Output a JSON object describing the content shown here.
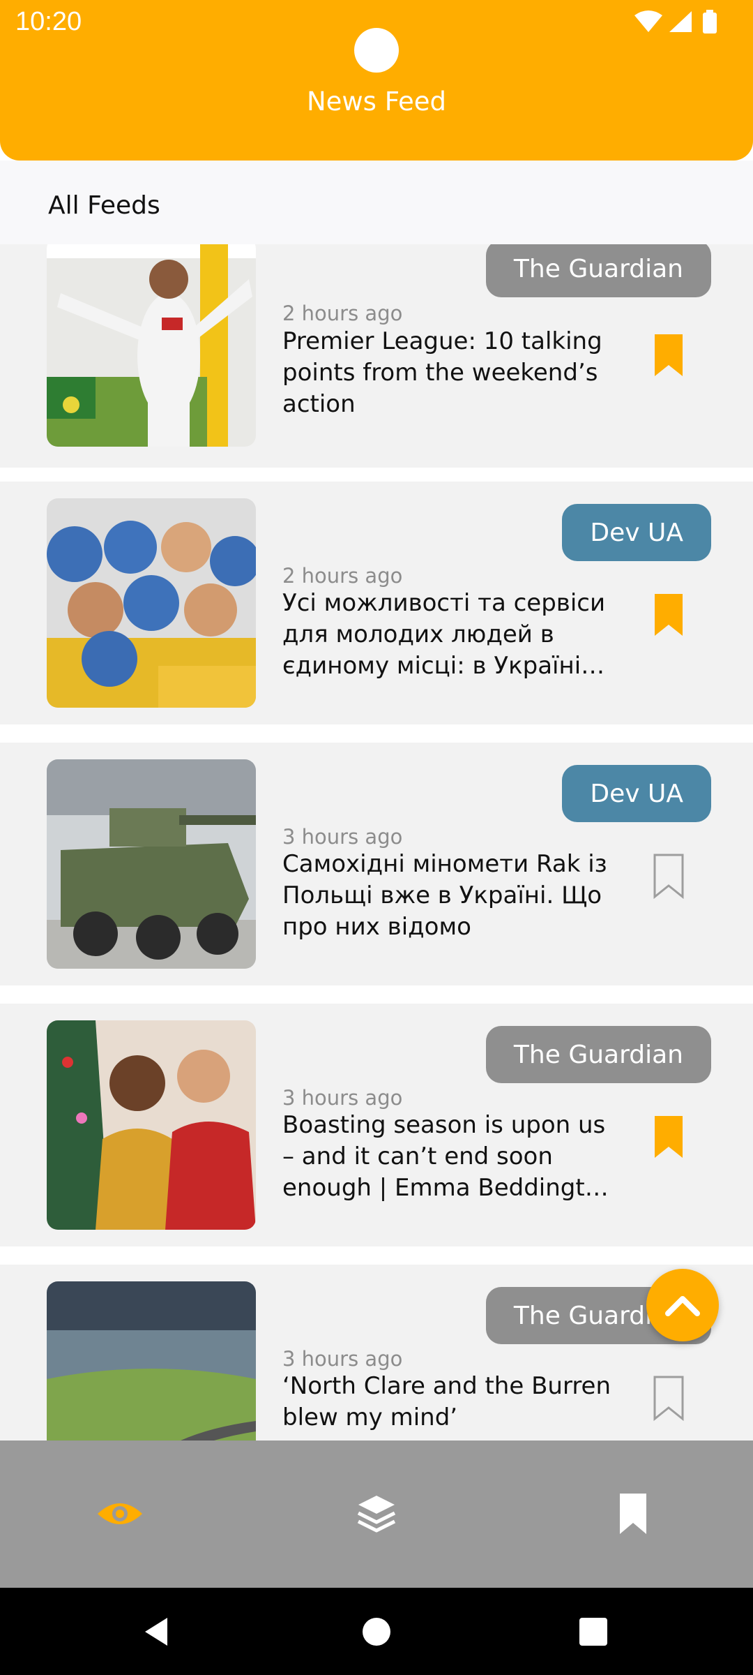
{
  "status_bar": {
    "time": "10:20"
  },
  "header": {
    "title": "News Feed"
  },
  "section": {
    "title": "All Feeds"
  },
  "articles": [
    {
      "source": "The Guardian",
      "time": "2 hours ago",
      "headline": "Premier League: 10 talking points from the weekend’s action",
      "bookmarked": true
    },
    {
      "source": "Dev UA",
      "time": "2 hours ago",
      "headline": "Усі можливості та сервіси для молодих людей в єдиному місці: в Україні с…",
      "bookmarked": true
    },
    {
      "source": "Dev UA",
      "time": "3 hours ago",
      "headline": "Самохідні міномети Rak із Польщі вже в Україні. Що про них відомо",
      "bookmarked": false
    },
    {
      "source": "The Guardian",
      "time": "3 hours ago",
      "headline": "Boasting season is upon us – and it can’t end soon enough | Emma Beddingt…",
      "bookmarked": true
    },
    {
      "source": "The Guardian",
      "time": "3 hours ago",
      "headline": "‘North Clare and the Burren blew my mind’",
      "bookmarked": false
    }
  ],
  "bottom_nav": [
    "eye-icon",
    "layers-icon",
    "bookmark-icon"
  ],
  "colors": {
    "accent": "#FFAD00",
    "guardian_badge": "#8f8f8f",
    "dev_badge": "#4C87A6"
  }
}
